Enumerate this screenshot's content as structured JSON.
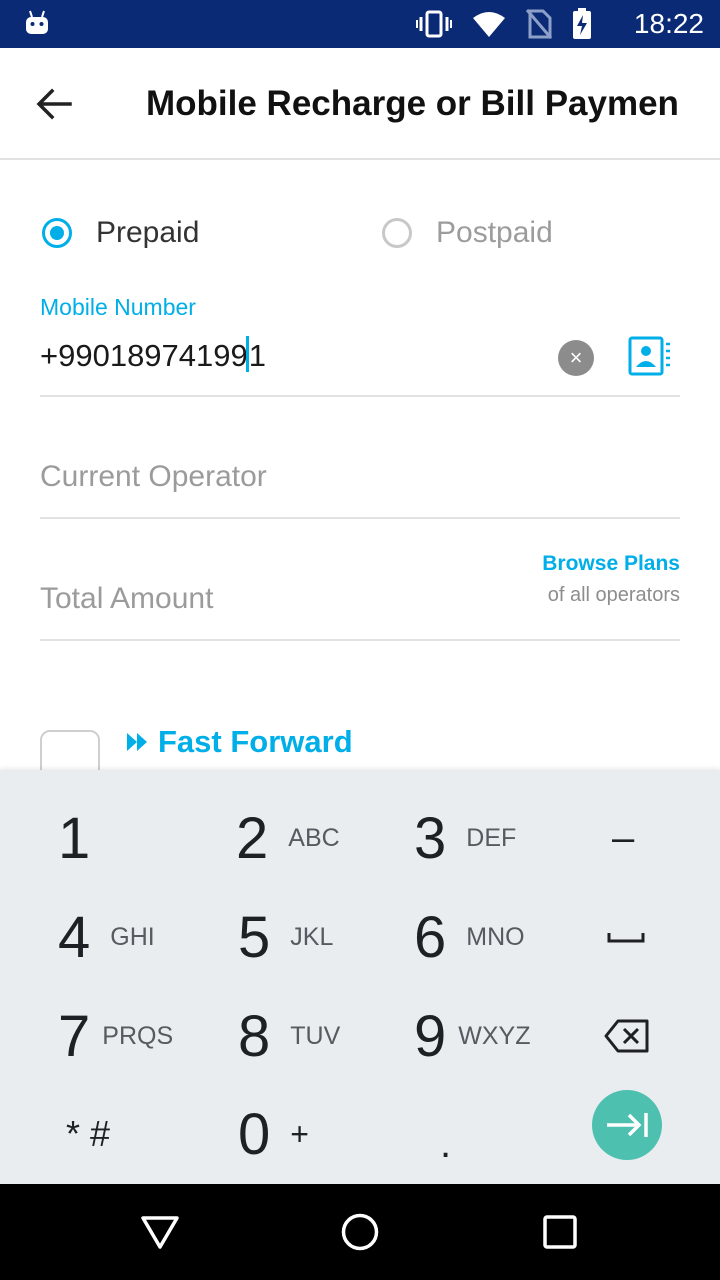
{
  "status_bar": {
    "time": "18:22",
    "icons": [
      "android-icon",
      "vibrate-icon",
      "wifi-icon",
      "no-sim-icon",
      "battery-charging-icon"
    ]
  },
  "toolbar": {
    "title": "Mobile Recharge or Bill Paymen"
  },
  "plan_type": {
    "options": [
      {
        "label": "Prepaid",
        "selected": true
      },
      {
        "label": "Postpaid",
        "selected": false
      }
    ]
  },
  "mobile_number": {
    "label": "Mobile Number",
    "value_before_cursor": "+99018974199",
    "value_after_cursor": "1",
    "clear_symbol": "×"
  },
  "operator": {
    "placeholder": "Current Operator"
  },
  "amount": {
    "placeholder": "Total Amount",
    "browse_link": "Browse Plans",
    "browse_sub": "of all operators"
  },
  "fast_forward": {
    "label": "Fast Forward"
  },
  "keyboard": {
    "keys": [
      {
        "num": "1",
        "letters": ""
      },
      {
        "num": "2",
        "letters": "ABC"
      },
      {
        "num": "3",
        "letters": "DEF"
      },
      {
        "num": "4",
        "letters": "GHI"
      },
      {
        "num": "5",
        "letters": "JKL"
      },
      {
        "num": "6",
        "letters": "MNO"
      },
      {
        "num": "7",
        "letters": "PRQS"
      },
      {
        "num": "8",
        "letters": "TUV"
      },
      {
        "num": "9",
        "letters": "WXYZ"
      },
      {
        "num": "0",
        "letters": "+"
      }
    ],
    "symbols_label": "* #",
    "minus": "–",
    "period": "."
  },
  "colors": {
    "accent": "#00aee8",
    "status_bar": "#0a2a75",
    "enter_button": "#4ec0b0",
    "keyboard_bg": "#eaedf0"
  }
}
